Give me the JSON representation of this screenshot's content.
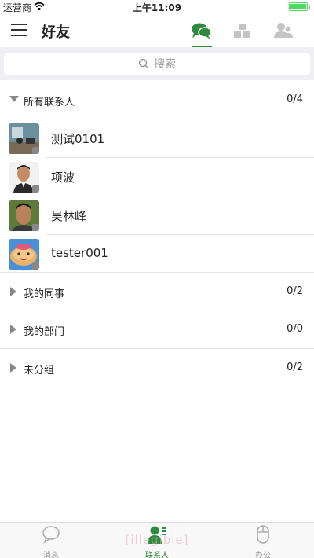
{
  "status_bar": {
    "carrier": "运营商",
    "time": "上午11:09"
  },
  "header": {
    "title": "好友"
  },
  "search": {
    "placeholder": "搜索"
  },
  "groups": {
    "all": {
      "label": "所有联系人",
      "count": "0/4"
    },
    "colleagues": {
      "label": "我的同事",
      "count": "0/2"
    },
    "department": {
      "label": "我的部门",
      "count": "0/0"
    },
    "ungrouped": {
      "label": "未分组",
      "count": "0/2"
    }
  },
  "contacts": [
    {
      "name": "测试0101"
    },
    {
      "name": "项波"
    },
    {
      "name": "吴林峰"
    },
    {
      "name": "tester001"
    }
  ],
  "tab_bar": {
    "messages": "消息",
    "contacts": "联系人",
    "office": "办公",
    "watermark": "[illegible]"
  },
  "colors": {
    "accent": "#2e8a3c",
    "battery": "#4cd964"
  },
  "icons": [
    "menu-icon",
    "chat-bubbles-icon",
    "org-chart-icon",
    "contacts-icon",
    "search-icon",
    "caret-down-icon",
    "caret-right-icon",
    "message-icon",
    "contact-person-icon",
    "mouse-icon"
  ]
}
